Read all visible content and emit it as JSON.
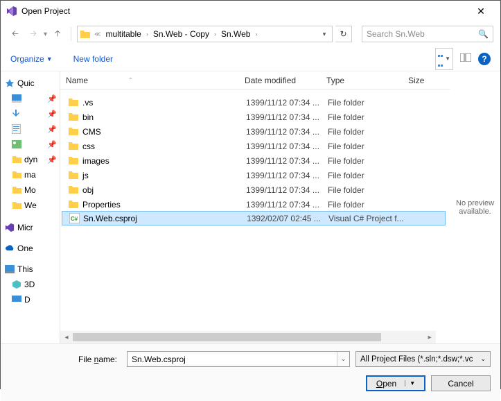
{
  "title": "Open Project",
  "breadcrumbs": {
    "b0": "multitable",
    "b1": "Sn.Web - Copy",
    "b2": "Sn.Web"
  },
  "search": {
    "placeholder": "Search Sn.Web"
  },
  "toolbar": {
    "organize": "Organize",
    "newfolder": "New folder"
  },
  "columns": {
    "name": "Name",
    "date": "Date modified",
    "type": "Type",
    "size": "Size"
  },
  "tree": {
    "quick": "Quic",
    "dyn": "dyn",
    "ma": "ma",
    "mo": "Mo",
    "we": "We",
    "micr": "Micr",
    "one": "One",
    "this": "This",
    "three": "3D",
    "d": "D"
  },
  "items": [
    {
      "name": ".vs",
      "date": "1399/11/12 07:34 ...",
      "type": "File folder",
      "icon": "folder"
    },
    {
      "name": "bin",
      "date": "1399/11/12 07:34 ...",
      "type": "File folder",
      "icon": "folder"
    },
    {
      "name": "CMS",
      "date": "1399/11/12 07:34 ...",
      "type": "File folder",
      "icon": "folder"
    },
    {
      "name": "css",
      "date": "1399/11/12 07:34 ...",
      "type": "File folder",
      "icon": "folder"
    },
    {
      "name": "images",
      "date": "1399/11/12 07:34 ...",
      "type": "File folder",
      "icon": "folder"
    },
    {
      "name": "js",
      "date": "1399/11/12 07:34 ...",
      "type": "File folder",
      "icon": "folder"
    },
    {
      "name": "obj",
      "date": "1399/11/12 07:34 ...",
      "type": "File folder",
      "icon": "folder"
    },
    {
      "name": "Properties",
      "date": "1399/11/12 07:34 ...",
      "type": "File folder",
      "icon": "folder"
    },
    {
      "name": "Sn.Web.csproj",
      "date": "1392/02/07 02:45 ...",
      "type": "Visual C# Project f...",
      "icon": "csproj",
      "selected": true
    }
  ],
  "preview": "No preview available.",
  "fileLabel": "File name:",
  "fileValue": "Sn.Web.csproj",
  "filter": "All Project Files (*.sln;*.dsw;*.vc",
  "buttons": {
    "open": "Open",
    "cancel": "Cancel"
  }
}
